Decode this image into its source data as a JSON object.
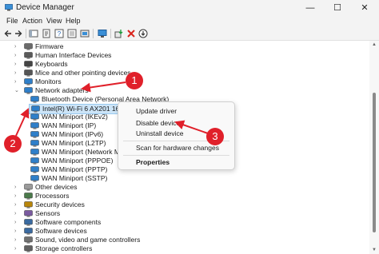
{
  "window": {
    "title": "Device Manager",
    "minimize": "—",
    "maximize": "☐",
    "close": "✕"
  },
  "menu": [
    "File",
    "Action",
    "View",
    "Help"
  ],
  "tree": {
    "items": [
      {
        "label": "Firmware",
        "expander": "›",
        "icon": "firmware-icon"
      },
      {
        "label": "Human Interface Devices",
        "expander": "›",
        "icon": "hid-icon"
      },
      {
        "label": "Keyboards",
        "expander": "›",
        "icon": "keyboard-icon"
      },
      {
        "label": "Mice and other pointing devices",
        "expander": "›",
        "icon": "mouse-icon"
      },
      {
        "label": "Monitors",
        "expander": "›",
        "icon": "monitor-icon"
      },
      {
        "label": "Network adapters",
        "expander": "⌄",
        "icon": "network-adapter-icon"
      },
      {
        "label": "Bluetooth Device (Personal Area Network)",
        "expander": "",
        "icon": "network-adapter-icon"
      },
      {
        "label": "Intel(R) Wi-Fi 6 AX201 160MHz",
        "expander": "",
        "icon": "network-adapter-icon",
        "selected": true
      },
      {
        "label": "WAN Miniport (IKEv2)",
        "expander": "",
        "icon": "network-adapter-icon"
      },
      {
        "label": "WAN Miniport (IP)",
        "expander": "",
        "icon": "network-adapter-icon"
      },
      {
        "label": "WAN Miniport (IPv6)",
        "expander": "",
        "icon": "network-adapter-icon"
      },
      {
        "label": "WAN Miniport (L2TP)",
        "expander": "",
        "icon": "network-adapter-icon"
      },
      {
        "label": "WAN Miniport (Network Mon",
        "expander": "",
        "icon": "network-adapter-icon"
      },
      {
        "label": "WAN Miniport (PPPOE)",
        "expander": "",
        "icon": "network-adapter-icon"
      },
      {
        "label": "WAN Miniport (PPTP)",
        "expander": "",
        "icon": "network-adapter-icon"
      },
      {
        "label": "WAN Miniport (SSTP)",
        "expander": "",
        "icon": "network-adapter-icon"
      },
      {
        "label": "Other devices",
        "expander": "›",
        "icon": "other-devices-icon"
      },
      {
        "label": "Processors",
        "expander": "›",
        "icon": "processor-icon"
      },
      {
        "label": "Security devices",
        "expander": "›",
        "icon": "security-icon"
      },
      {
        "label": "Sensors",
        "expander": "›",
        "icon": "sensor-icon"
      },
      {
        "label": "Software components",
        "expander": "›",
        "icon": "software-icon"
      },
      {
        "label": "Software devices",
        "expander": "›",
        "icon": "software-icon"
      },
      {
        "label": "Sound, video and game controllers",
        "expander": "›",
        "icon": "sound-icon"
      },
      {
        "label": "Storage controllers",
        "expander": "›",
        "icon": "storage-icon"
      }
    ]
  },
  "context_menu": {
    "items": [
      "Update driver",
      "Disable device",
      "Uninstall device",
      "Scan for hardware changes",
      "Properties"
    ]
  },
  "annotations": [
    "1",
    "2",
    "3"
  ],
  "colors": {
    "accent_red": "#e0202a",
    "selection": "#cce4f7",
    "chrome": "#f3f3f3"
  }
}
